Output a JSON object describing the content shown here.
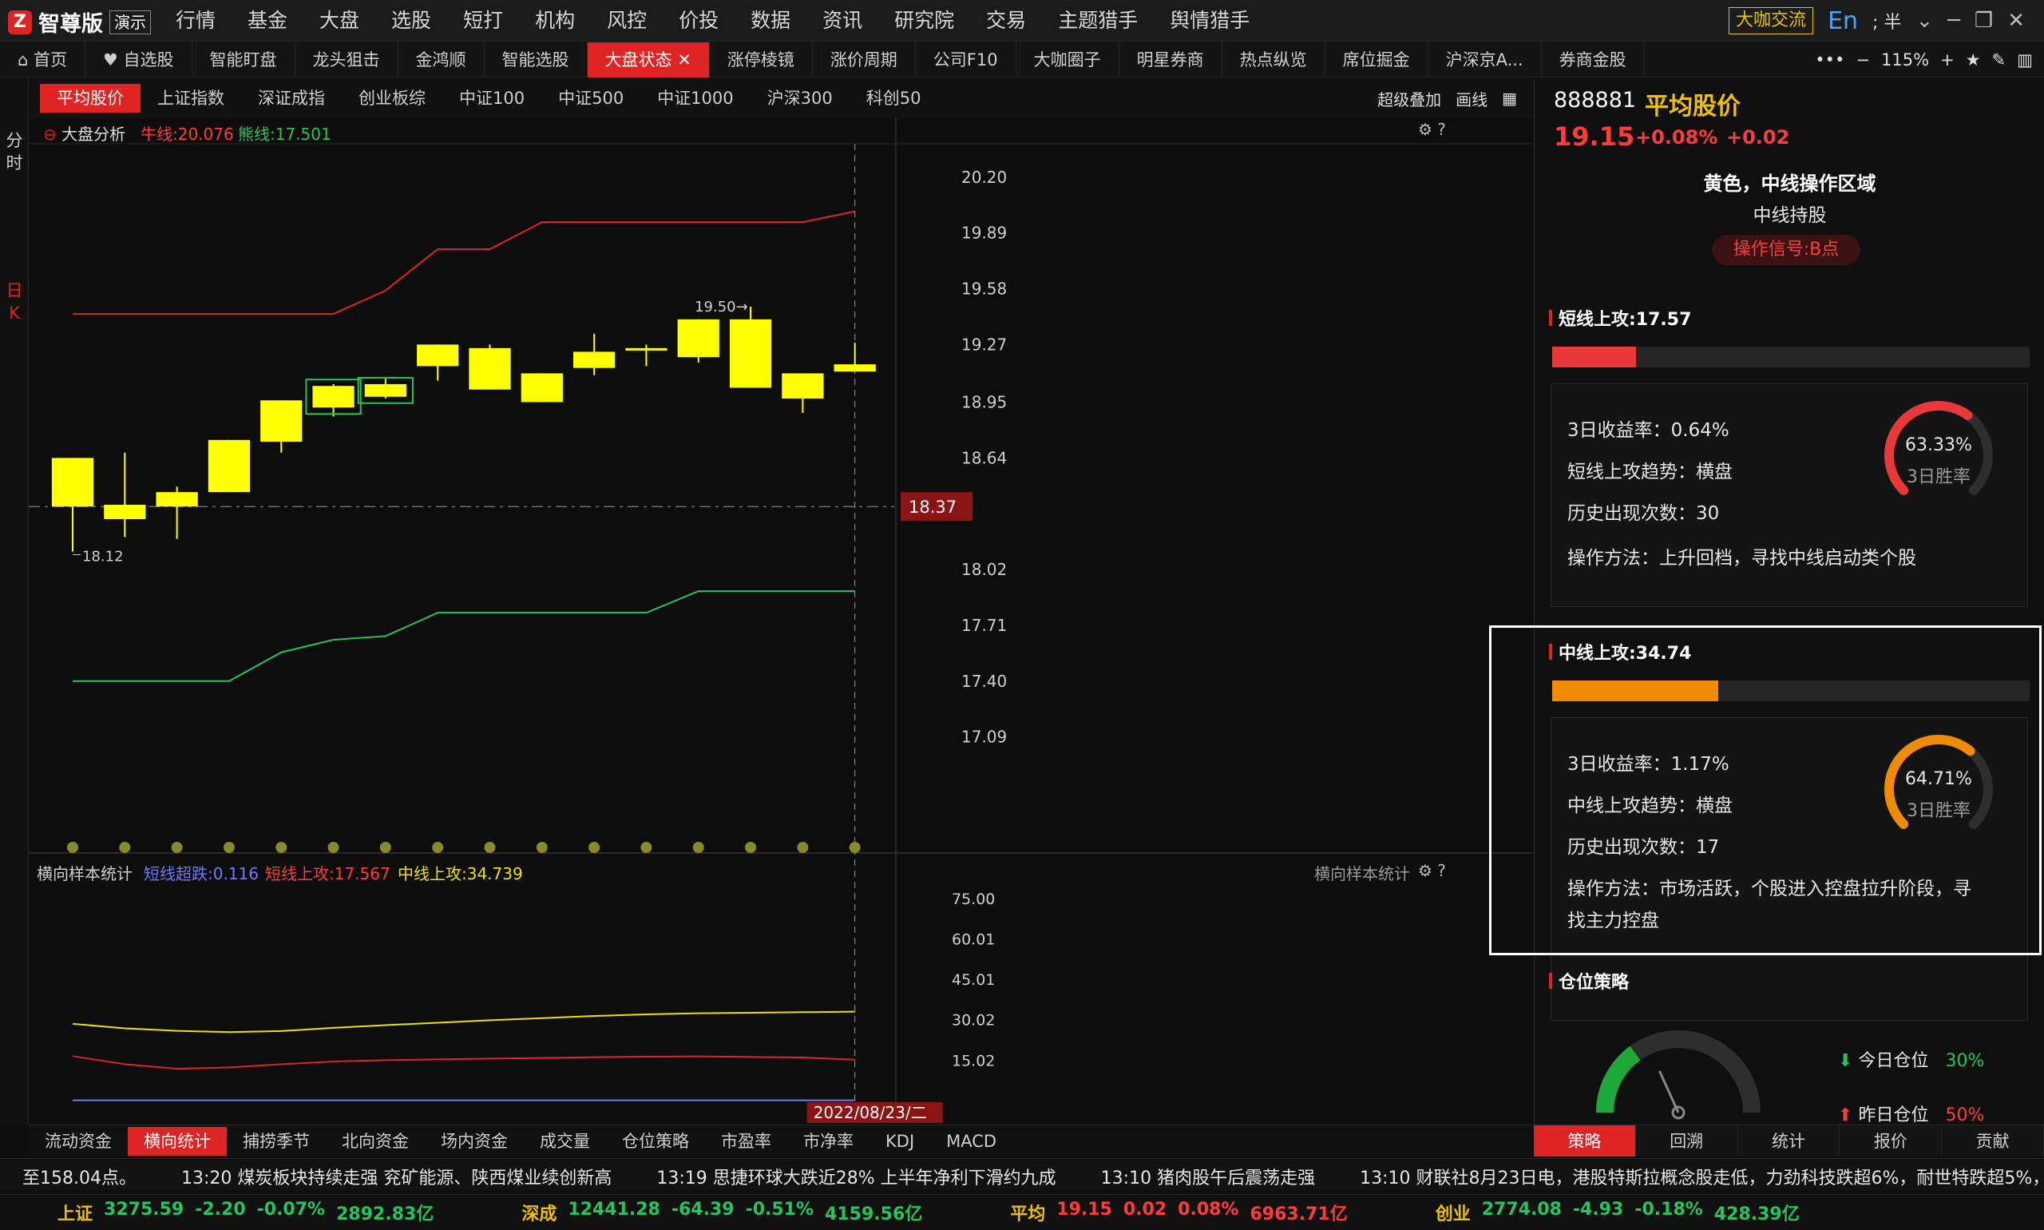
{
  "topbar": {
    "logo_text": "智尊版",
    "demo": "演示",
    "menu": [
      "行情",
      "基金",
      "大盘",
      "选股",
      "短打",
      "机构",
      "风控",
      "价投",
      "数据",
      "资讯",
      "研究院",
      "交易",
      "主题猎手",
      "舆情猎手"
    ],
    "cafe": "大咖交流",
    "ime": "En",
    "ime_extra": "; 半"
  },
  "tabs": {
    "items": [
      "首页",
      "自选股",
      "智能盯盘",
      "龙头狙击",
      "金鸿顺",
      "智能选股",
      "大盘状态",
      "涨停棱镜",
      "涨价周期",
      "公司F10",
      "大咖圈子",
      "明星券商",
      "热点纵览",
      "席位掘金",
      "沪深京A...",
      "券商金股"
    ],
    "active": "大盘状态",
    "zoom": "115%"
  },
  "left_strip": {
    "fen": "分",
    "shi": "时",
    "ri": "日",
    "k": "K"
  },
  "indices": {
    "items": [
      "平均股价",
      "上证指数",
      "深证成指",
      "创业板综",
      "中证100",
      "中证500",
      "中证1000",
      "沪深300",
      "科创50"
    ],
    "active": "平均股价",
    "overlay": "超级叠加",
    "draw": "画线"
  },
  "chart_panel": {
    "title": "大盘分析",
    "bull_label": "牛线:20.076",
    "bear_label": "熊线:17.501",
    "high_label": "19.50",
    "low_label": "18.12",
    "current_tag": "18.37",
    "date_tag": "2022/08/23/二",
    "sub_title": "横向样本统计",
    "sub_a": "短线超跌:0.116",
    "sub_b": "短线上攻:17.567",
    "sub_c": "中线上攻:34.739",
    "sub_right": "横向样本统计"
  },
  "chart_data": {
    "type": "candlestick",
    "main_ylim": [
      16.8,
      20.35
    ],
    "y_ticks": [
      "20.20",
      "19.89",
      "19.58",
      "19.27",
      "18.95",
      "18.64",
      "18.02",
      "17.71",
      "17.40",
      "17.09"
    ],
    "candles": [
      {
        "o": 18.37,
        "c": 18.64,
        "h": 18.64,
        "l": 18.12,
        "color": "yellow"
      },
      {
        "o": 18.3,
        "c": 18.38,
        "h": 18.67,
        "l": 18.2,
        "color": "yellow"
      },
      {
        "o": 18.37,
        "c": 18.45,
        "h": 18.48,
        "l": 18.19,
        "color": "yellow"
      },
      {
        "o": 18.45,
        "c": 18.74,
        "h": 18.74,
        "l": 18.45,
        "color": "yellow"
      },
      {
        "o": 18.73,
        "c": 18.96,
        "h": 18.96,
        "l": 18.67,
        "color": "yellow"
      },
      {
        "o": 18.92,
        "c": 19.04,
        "h": 19.05,
        "l": 18.87,
        "color": "yellow",
        "box": true
      },
      {
        "o": 18.98,
        "c": 19.05,
        "h": 19.08,
        "l": 18.97,
        "color": "yellow",
        "box": true
      },
      {
        "o": 19.15,
        "c": 19.27,
        "h": 19.27,
        "l": 19.07,
        "color": "yellow"
      },
      {
        "o": 19.02,
        "c": 19.25,
        "h": 19.27,
        "l": 19.02,
        "color": "yellow"
      },
      {
        "o": 18.95,
        "c": 19.11,
        "h": 19.11,
        "l": 18.95,
        "color": "yellow"
      },
      {
        "o": 19.14,
        "c": 19.23,
        "h": 19.33,
        "l": 19.1,
        "color": "yellow"
      },
      {
        "o": 19.24,
        "c": 19.25,
        "h": 19.27,
        "l": 19.15,
        "color": "yellow"
      },
      {
        "o": 19.2,
        "c": 19.41,
        "h": 19.41,
        "l": 19.17,
        "color": "yellow"
      },
      {
        "o": 19.41,
        "c": 19.03,
        "h": 19.48,
        "l": 19.03,
        "color": "yellow"
      },
      {
        "o": 19.11,
        "c": 18.97,
        "h": 19.11,
        "l": 18.89,
        "color": "yellow"
      },
      {
        "o": 19.12,
        "c": 19.16,
        "h": 19.28,
        "l": 19.12,
        "color": "yellow"
      }
    ],
    "bull_line": [
      19.44,
      19.44,
      19.44,
      19.44,
      19.44,
      19.44,
      19.57,
      19.8,
      19.8,
      19.95,
      19.95,
      19.95,
      19.95,
      19.95,
      19.95,
      20.01
    ],
    "bear_line": [
      17.4,
      17.4,
      17.4,
      17.4,
      17.56,
      17.63,
      17.65,
      17.78,
      17.78,
      17.78,
      17.78,
      17.78,
      17.9,
      17.9,
      17.9,
      17.9
    ],
    "current_line": 18.37,
    "sub_ylim": [
      0,
      80
    ],
    "sub_ticks": [
      "75.00",
      "60.01",
      "45.01",
      "30.02",
      "15.02"
    ],
    "sub_yellow": [
      28.5,
      26.8,
      25.9,
      25.4,
      25.8,
      27.0,
      28.0,
      28.9,
      29.8,
      30.6,
      31.4,
      32.0,
      32.4,
      32.6,
      32.8,
      33.0
    ],
    "sub_red": [
      16.5,
      13.5,
      11.8,
      12.3,
      13.5,
      14.5,
      15.0,
      15.3,
      15.6,
      15.8,
      16.1,
      16.3,
      16.4,
      16.2,
      16.0,
      15.2
    ],
    "sub_blue": [
      0.1,
      0.1,
      0.1,
      0.1,
      0.1,
      0.1,
      0.1,
      0.1,
      0.1,
      0.1,
      0.1,
      0.1,
      0.1,
      0.1,
      0.1,
      0.1
    ]
  },
  "right": {
    "code": "888881",
    "name": "平均股价",
    "price": "19.15",
    "chg_pct": "+0.08%",
    "chg": "+0.02",
    "zone": "黄色，中线操作区域",
    "hold": "中线持股",
    "signal": "操作信号:B点",
    "short": {
      "title": "短线上攻:17.57",
      "fill": 0.1757,
      "color": "#e8383a",
      "ret": "3日收益率：0.64%",
      "trend": "短线上攻趋势：横盘",
      "count": "历史出现次数：30",
      "method": "操作方法：上升回档，寻找中线启动类个股",
      "win": "63.33%",
      "win_label": "3日胜率",
      "win_val": 0.6333
    },
    "mid": {
      "title": "中线上攻:34.74",
      "fill": 0.3474,
      "color": "#f08a00",
      "ret": "3日收益率：1.17%",
      "trend": "中线上攻趋势：横盘",
      "count": "历史出现次数：17",
      "method1": "操作方法：市场活跃，个股进入控盘拉升阶段，寻",
      "method2": "找主力控盘",
      "win": "64.71%",
      "win_label": "3日胜率",
      "win_val": 0.6471
    },
    "position": {
      "title": "仓位策略",
      "today_label": "今日仓位",
      "today_val": "30%",
      "yest_label": "昨日仓位",
      "yest_val": "50%",
      "level": 0.3
    }
  },
  "bottom_tabs": [
    "流动资金",
    "横向统计",
    "捕捞季节",
    "北向资金",
    "场内资金",
    "成交量",
    "仓位策略",
    "市盈率",
    "市净率",
    "KDJ",
    "MACD"
  ],
  "bottom_active": "横向统计",
  "right_tabs": [
    "策略",
    "回溯",
    "统计",
    "报价",
    "贡献"
  ],
  "right_active": "策略",
  "news": [
    "至158.04点。",
    "13:20 煤炭板块持续走强 兖矿能源、陕西煤业续创新高",
    "13:19 思捷环球大跌近28% 上半年净利下滑约九成",
    "13:10 猪肉股午后震荡走强",
    "13:10 财联社8月23日电，港股特斯拉概念股走低，力劲科技跌超6%，耐世特跌超5%，敏"
  ],
  "status": [
    {
      "name": "上证",
      "val": "3275.59",
      "chg": "-2.20",
      "pct": "-0.07%",
      "amt": "2892.83亿",
      "dir": "down"
    },
    {
      "name": "深成",
      "val": "12441.28",
      "chg": "-64.39",
      "pct": "-0.51%",
      "amt": "4159.56亿",
      "dir": "down"
    },
    {
      "name": "平均",
      "val": "19.15",
      "chg": "0.02",
      "pct": "0.08%",
      "amt": "6963.71亿",
      "dir": "up"
    },
    {
      "name": "创业",
      "val": "2774.08",
      "chg": "-4.93",
      "pct": "-0.18%",
      "amt": "428.39亿",
      "dir": "down"
    }
  ]
}
